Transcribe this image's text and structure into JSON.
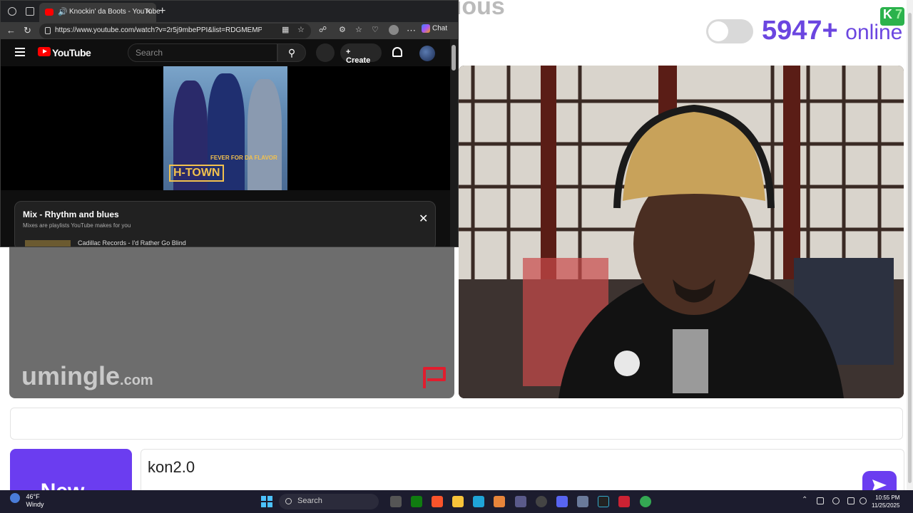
{
  "browser": {
    "tab_title": "Knockin' da Boots - YouTube",
    "url": "https://www.youtube.com/watch?v=2r5j9mbePPI&list=RDGMEMP-96bLto...",
    "chat_label": "Chat"
  },
  "youtube": {
    "brand": "YouTube",
    "search_placeholder": "Search",
    "create_label": "Create",
    "album": {
      "title": "H-TOWN",
      "subtitle": "FEVER FOR DA FLAVOR"
    },
    "mix": {
      "title": "Mix - Rhythm and blues",
      "subtitle": "Mixes are playlists YouTube makes for you",
      "first_item": "Cadillac Records - I'd Rather Go Blind"
    }
  },
  "page": {
    "brand_name": "Konsxious",
    "badge_letter": "K",
    "badge_count": "7",
    "online_count": "5947+",
    "online_label": "online",
    "watermark_main": "umingle",
    "watermark_domain": ".com",
    "new_button_label": "New...",
    "message_value": "kon2.0"
  },
  "taskbar": {
    "weather_temp": "46°F",
    "weather_desc": "Windy",
    "search_label": "Search",
    "time": "10:55 PM",
    "date": "11/25/2025"
  },
  "colors": {
    "accent": "#6b3df0",
    "online_text": "#6b46e0",
    "youtube_red": "#ff0000",
    "album_gold": "#f2c14e"
  }
}
